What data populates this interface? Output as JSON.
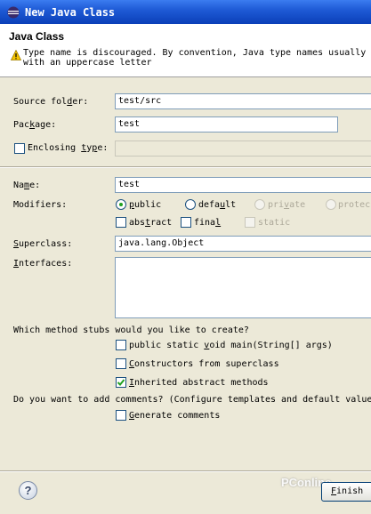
{
  "window": {
    "title": "New Java Class"
  },
  "banner": {
    "title": "Java Class",
    "message": "Type name is discouraged. By convention, Java type names usually s\nwith an uppercase letter"
  },
  "source_folder": {
    "label_pre": "Source fol",
    "label_key": "d",
    "label_post": "er:",
    "value": "test/src"
  },
  "package": {
    "label_pre": "Pac",
    "label_key": "k",
    "label_post": "age:",
    "value": "test"
  },
  "enclosing": {
    "label_pre": "Enclosing ",
    "label_key": "t",
    "label_mid": "y",
    "label_key2": "p",
    "label_post": "e:",
    "checked": false,
    "value": ""
  },
  "name": {
    "label_pre": "Na",
    "label_key": "m",
    "label_post": "e:",
    "value": "test"
  },
  "modifiers": {
    "label": "Modifiers:",
    "public": {
      "label_key": "p",
      "label_post": "ublic",
      "selected": true
    },
    "default": {
      "label_pre": "defa",
      "label_key": "u",
      "label_post": "lt",
      "selected": false
    },
    "private": {
      "label_pre": "pri",
      "label_key": "v",
      "label_post": "ate",
      "enabled": false
    },
    "protected": {
      "label": "protec",
      "enabled": false
    },
    "abstract": {
      "label_pre": "abs",
      "label_key": "t",
      "label_post": "ract",
      "checked": false
    },
    "final": {
      "label_pre": "fina",
      "label_key": "l",
      "checked": false
    },
    "static": {
      "label": "static",
      "enabled": false
    }
  },
  "superclass": {
    "label_key": "S",
    "label_post": "uperclass:",
    "value": "java.lang.Object"
  },
  "interfaces": {
    "label_key": "I",
    "label_post": "nterfaces:"
  },
  "stubs": {
    "question": "Which method stubs would you like to create?",
    "main": {
      "pre": "public static ",
      "key": "v",
      "post": "oid main(String[] args)",
      "checked": false
    },
    "constructors": {
      "key": "C",
      "post": "onstructors from superclass",
      "checked": false
    },
    "inherited": {
      "key": "I",
      "post": "nherited abstract methods",
      "checked": true
    }
  },
  "comments": {
    "question": "Do you want to add comments? (Configure templates and default value h",
    "generate": {
      "key": "G",
      "post": "enerate comments",
      "checked": false
    }
  },
  "footer": {
    "help": "?",
    "finish": {
      "key": "F",
      "post": "inish"
    },
    "watermark": "PConline"
  },
  "colors": {
    "title_bar": "#1f5bd6",
    "check_mark": "#21a121",
    "dialog_bg": "#ece9d8"
  }
}
